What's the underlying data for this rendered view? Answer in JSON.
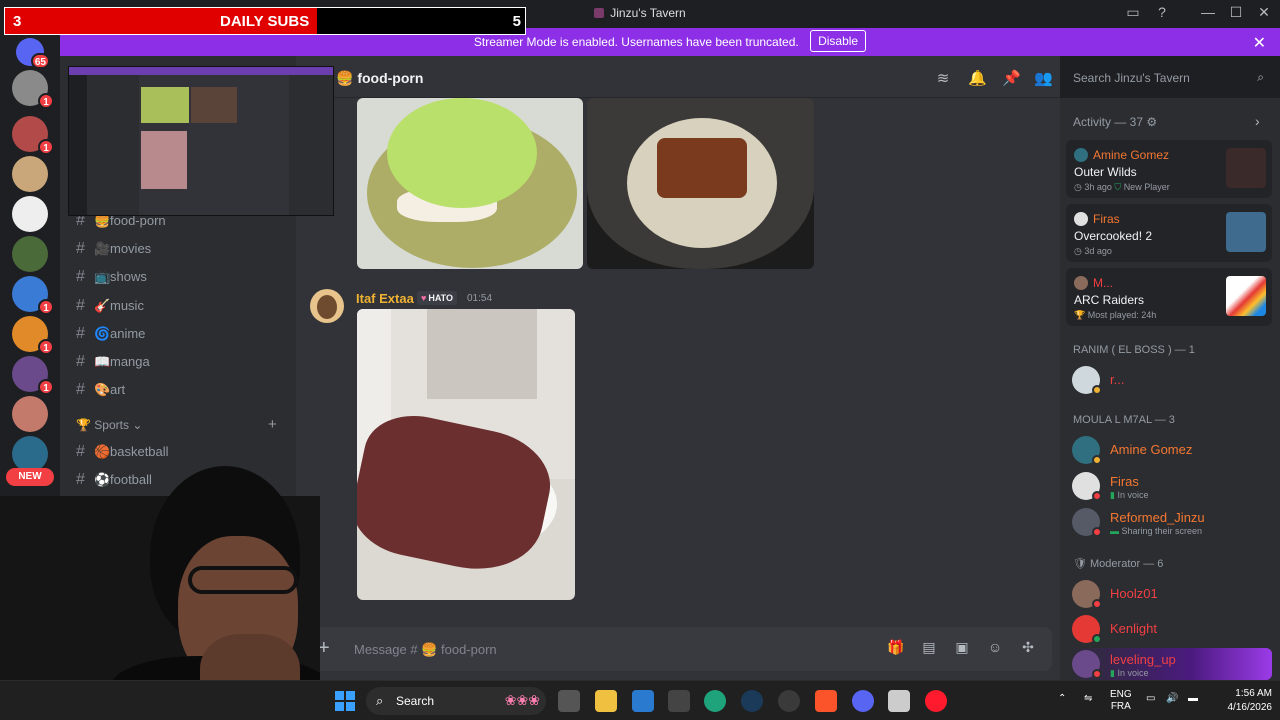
{
  "window": {
    "title": "Jinzu's Tavern",
    "minimize": "—",
    "maximize": "☐",
    "close": "✕"
  },
  "subs": {
    "left": "3",
    "title": "DAILY SUBS",
    "right": "5",
    "fill_fraction": 0.6
  },
  "banner": {
    "text": "Streamer Mode is enabled. Usernames have been truncated.",
    "button": "Disable",
    "close": "✕"
  },
  "rail": {
    "badges": [
      "65",
      "1",
      "1",
      "1",
      "1",
      "1"
    ],
    "new": "NEW"
  },
  "channels": [
    {
      "emoji": "🍔",
      "name": "food-porn"
    },
    {
      "emoji": "🎥",
      "name": "movies"
    },
    {
      "emoji": "📺",
      "name": "shows"
    },
    {
      "emoji": "🎸",
      "name": "music"
    },
    {
      "emoji": "🌀",
      "name": "anime"
    },
    {
      "emoji": "📖",
      "name": "manga"
    },
    {
      "emoji": "🎨",
      "name": "art"
    }
  ],
  "category": {
    "emoji": "🏆",
    "name": "Sports",
    "chevron": "⌄",
    "add": "+"
  },
  "sports_channels": [
    {
      "emoji": "🏀",
      "name": "basketball"
    },
    {
      "emoji": "⚽",
      "name": "football"
    }
  ],
  "header": {
    "channel": "🍔 food-porn"
  },
  "search": {
    "placeholder": "Search Jinzu's Tavern"
  },
  "message": {
    "author": "Itaf Extaa",
    "tag": "HATO",
    "time": "01:54"
  },
  "composer": {
    "placeholder": "Message # 🍔 food-porn"
  },
  "activity": {
    "title": "Activity — 37 ⚙",
    "cards": [
      {
        "name": "Amine Gomez",
        "name_color": "#f57731",
        "game": "Outer Wilds",
        "meta": "3h ago",
        "extra": "New Player",
        "art": "#3a2a2a"
      },
      {
        "name": "Firas",
        "name_color": "#f57731",
        "game": "Overcooked! 2",
        "meta": "3d ago",
        "extra": "",
        "art": "#3f6b8f"
      },
      {
        "name": "M...",
        "name_color": "#f23f43",
        "game": "ARC Raiders",
        "meta": "Most played: 24h",
        "extra": "",
        "art": "#ffffff"
      }
    ]
  },
  "groups": [
    {
      "title": "RANIM ( EL BOSS ) — 1",
      "members": [
        {
          "name": "r...",
          "sub": "",
          "color": "#f23f43",
          "avatar": "#cfd8dc",
          "status": "#f0b232"
        }
      ]
    },
    {
      "title": "MOULA L M7AL — 3",
      "members": [
        {
          "name": "Amine Gomez",
          "sub": "",
          "color": "#f57731",
          "avatar": "#2f6f7f",
          "status": "#f0b232"
        },
        {
          "name": "Firas",
          "sub": "In voice",
          "color": "#f57731",
          "avatar": "#e0e0e0",
          "status": "#f23f43"
        },
        {
          "name": "Reformed_Jinzu",
          "sub": "Sharing their screen",
          "color": "#f57731",
          "avatar": "#555a66",
          "status": "#f23f43"
        }
      ]
    },
    {
      "title": "🛡 Moderator — 6",
      "members": [
        {
          "name": "Hoolz01",
          "sub": "",
          "color": "#f23f43",
          "avatar": "#8a6a5a",
          "status": "#f23f43"
        },
        {
          "name": "Kenlight",
          "sub": "",
          "color": "#f23f43",
          "avatar": "#e53935",
          "status": "#23a55a"
        },
        {
          "name": "leveling_up",
          "sub": "In voice",
          "color": "#f23f43",
          "avatar": "#6a4a8a",
          "status": "#f23f43"
        }
      ]
    }
  ],
  "taskbar": {
    "search": "Search",
    "tray_lang": "ENG",
    "tray_region": "FRA",
    "time": "1:56 AM",
    "date": "4/16/2026"
  }
}
